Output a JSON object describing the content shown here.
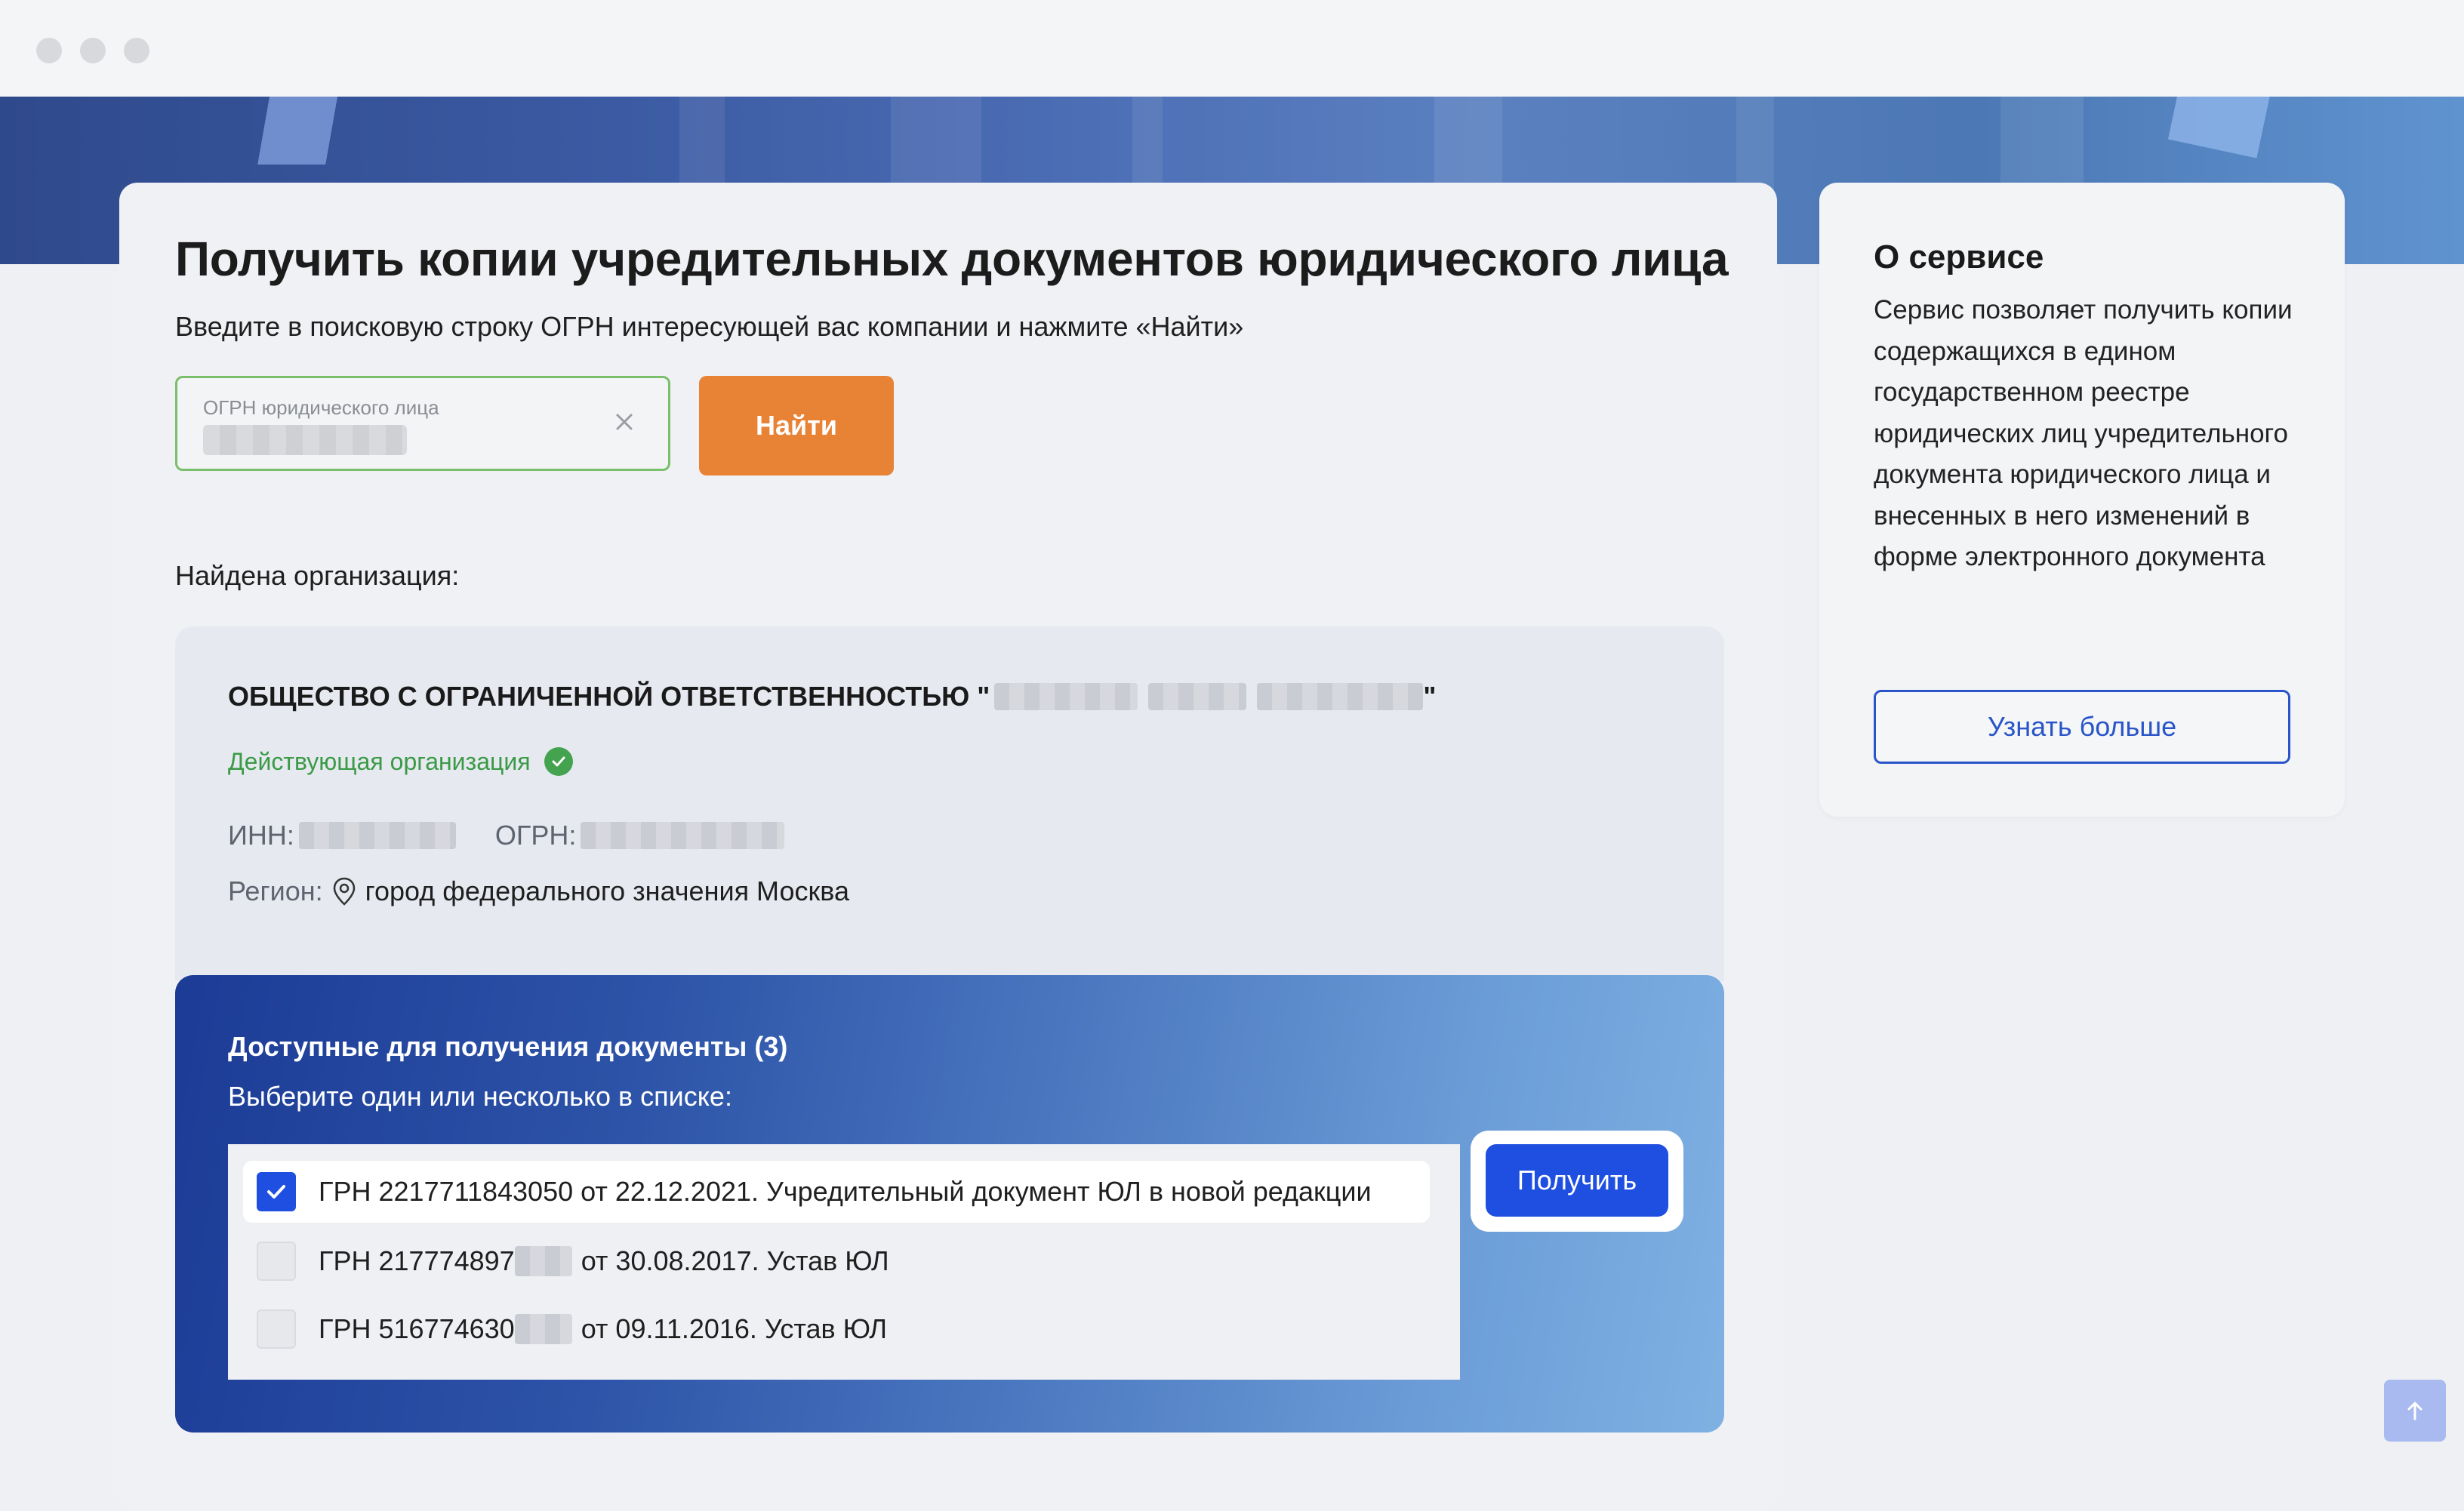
{
  "page": {
    "title": "Получить копии учредительных документов юридического лица",
    "subtitle": "Введите в поисковую строку ОГРН интересующей вас компании и нажмите «Найти»"
  },
  "search": {
    "label": "ОГРН юридического лица",
    "button_label": "Найти"
  },
  "result": {
    "found_label": "Найдена организация:",
    "org_name_prefix": "ОБЩЕСТВО С ОГРАНИЧЕННОЙ ОТВЕТСТВЕННОСТЬЮ \"",
    "org_name_suffix": "\"",
    "status": "Действующая организация",
    "inn_label": "ИНН:",
    "ogrn_label": "ОГРН:",
    "region_label": "Регион:",
    "region_value": "город федерального значения Москва"
  },
  "documents": {
    "title": "Доступные для получения документы (3)",
    "subtitle": "Выберите один или несколько в списке:",
    "items": [
      {
        "text": "ГРН 2217711843050 от 22.12.2021. Учредительный документ ЮЛ в новой редакции",
        "checked": true
      },
      {
        "prefix": "ГРН 217774897",
        "suffix": "от 30.08.2017. Устав ЮЛ",
        "checked": false
      },
      {
        "prefix": "ГРН 516774630",
        "suffix": "от 09.11.2016. Устав ЮЛ",
        "checked": false
      }
    ],
    "get_button_label": "Получить"
  },
  "sidebar": {
    "title": "О сервисе",
    "text": "Сервис позволяет получить копии содержащихся в едином государственном реестре юридических лиц учредительного документа юридического лица и внесенных в него изменений в форме электронного документа",
    "learn_more_label": "Узнать больше"
  },
  "colors": {
    "accent_orange": "#e88336",
    "primary_blue": "#1f4fe0",
    "status_green": "#3a9a45"
  },
  "icons": [
    "clear-icon",
    "check-circle-icon",
    "location-pin-icon",
    "checkbox-checked-icon",
    "arrow-up-icon"
  ]
}
